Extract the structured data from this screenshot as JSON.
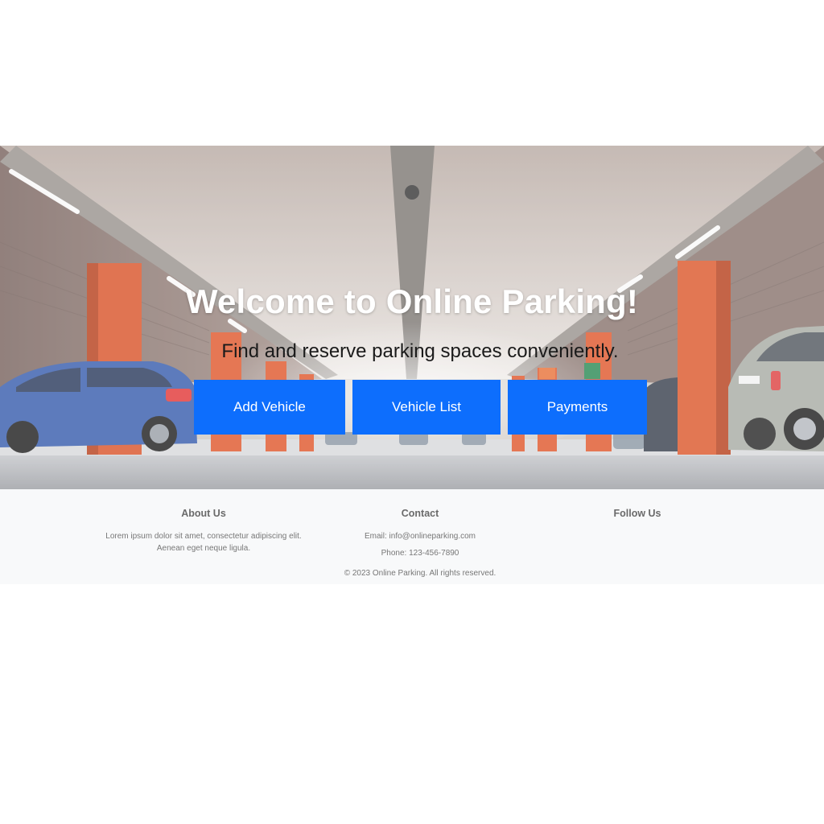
{
  "hero": {
    "title": "Welcome to Online Parking!",
    "subtitle": "Find and reserve parking spaces conveniently.",
    "buttons": {
      "add_vehicle": "Add Vehicle",
      "vehicle_list": "Vehicle List",
      "payments": "Payments"
    },
    "background": "parking-garage-photo"
  },
  "footer": {
    "about": {
      "heading": "About Us",
      "line1": "Lorem ipsum dolor sit amet, consectetur adipiscing elit.",
      "line2": "Aenean eget neque ligula."
    },
    "contact": {
      "heading": "Contact",
      "email": "Email: info@onlineparking.com",
      "phone": "Phone: 123-456-7890"
    },
    "follow": {
      "heading": "Follow Us"
    },
    "copyright": "© 2023 Online Parking. All rights reserved."
  },
  "colors": {
    "button_blue": "#0d6efd",
    "footer_bg": "#f8f9fa"
  }
}
